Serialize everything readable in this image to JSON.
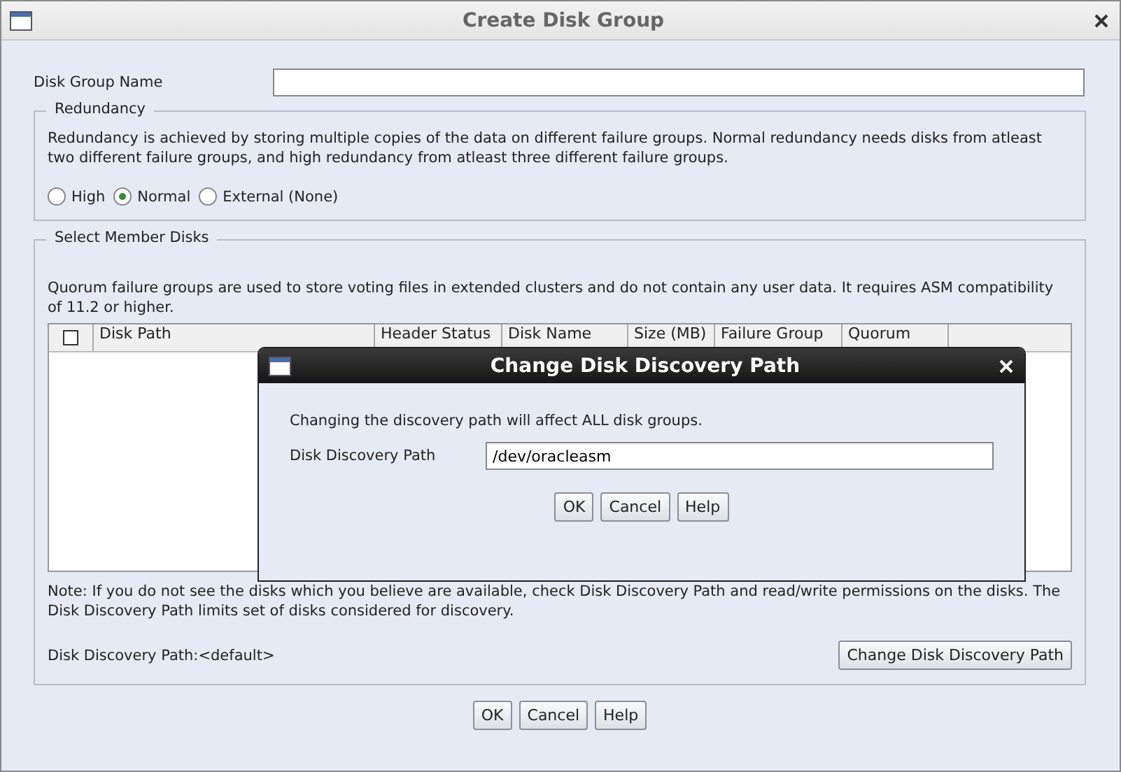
{
  "window": {
    "title": "Create Disk Group"
  },
  "disk_group_name": {
    "label": "Disk Group Name"
  },
  "redundancy": {
    "title": "Redundancy",
    "description": "Redundancy is achieved by storing multiple copies of the data on different failure groups. Normal redundancy needs disks from atleast two different failure groups, and high redundancy from atleast three different failure groups.",
    "options": [
      {
        "label": "High",
        "selected": false
      },
      {
        "label": "Normal",
        "selected": true
      },
      {
        "label": "External (None)",
        "selected": false
      }
    ]
  },
  "member_disks": {
    "title": "Select Member Disks",
    "description": "Quorum failure groups are used to store voting files in extended clusters and do not contain any user data. It requires ASM compatibility of 11.2 or higher.",
    "table": {
      "select_all_checked": false,
      "columns": [
        "Disk Path",
        "Header Status",
        "Disk Name",
        "Size (MB)",
        "Failure Group",
        "Quorum"
      ]
    },
    "note": "Note: If you do not see the disks which you believe are available, check Disk Discovery Path and read/write permissions on the disks. The Disk Discovery Path limits set of disks considered for discovery.",
    "discovery_path": "Disk Discovery Path:<default>",
    "change_button": "Change Disk Discovery Path"
  },
  "buttons": [
    "OK",
    "Cancel",
    "Help"
  ],
  "dialog": {
    "title": "Change Disk Discovery Path",
    "message": "Changing the discovery path will affect ALL disk groups.",
    "field_label": "Disk Discovery Path",
    "field_value": "/dev/oracleasm",
    "buttons": [
      "OK",
      "Cancel",
      "Help"
    ]
  }
}
